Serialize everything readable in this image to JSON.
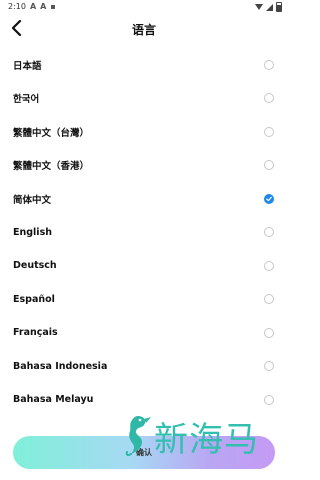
{
  "status_bar": {
    "time": "2:10",
    "notif_glyphs": [
      "A",
      "A",
      "▪"
    ],
    "icons": [
      "wifi-icon",
      "signal-icon",
      "battery-icon"
    ]
  },
  "header": {
    "title": "语言",
    "back_icon": "chevron-left-icon"
  },
  "languages": [
    {
      "label": "日本語",
      "selected": false
    },
    {
      "label": "한국어",
      "selected": false
    },
    {
      "label": "繁體中文（台灣）",
      "selected": false
    },
    {
      "label": "繁體中文（香港）",
      "selected": false
    },
    {
      "label": "简体中文",
      "selected": true
    },
    {
      "label": "English",
      "selected": false
    },
    {
      "label": "Deutsch",
      "selected": false
    },
    {
      "label": "Español",
      "selected": false
    },
    {
      "label": "Français",
      "selected": false
    },
    {
      "label": "Bahasa Indonesia",
      "selected": false
    },
    {
      "label": "Bahasa Melayu",
      "selected": false
    }
  ],
  "confirm_button": {
    "label": "确认"
  },
  "watermark": {
    "text": "新海马",
    "logo": "seahorse-logo"
  },
  "colors": {
    "accent": "#1e88e5",
    "button_gradient": [
      "#7ff0d8",
      "#a7d9f4",
      "#c49af5"
    ],
    "watermark": "#33bfb0"
  }
}
